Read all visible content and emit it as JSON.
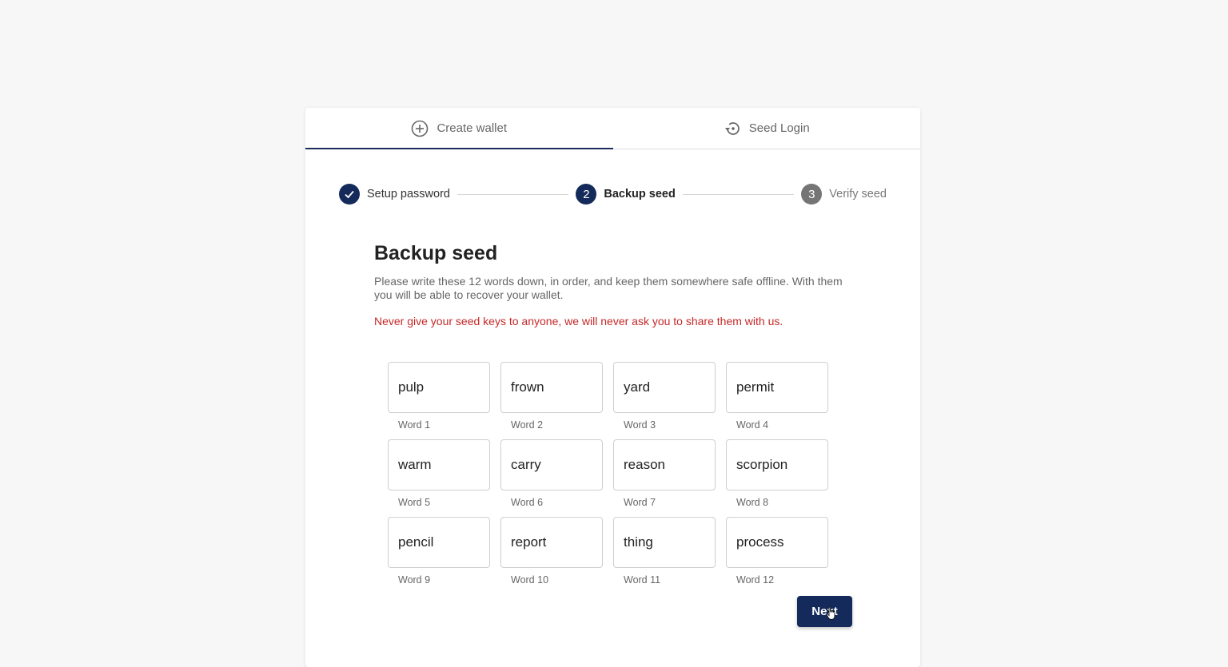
{
  "tabs": [
    {
      "label": "Create wallet",
      "icon": "plus-circle-icon",
      "active": true
    },
    {
      "label": "Seed Login",
      "icon": "restore-icon",
      "active": false
    }
  ],
  "stepper": {
    "steps": [
      {
        "label": "Setup password",
        "number": "",
        "status": "done"
      },
      {
        "label": "Backup seed",
        "number": "2",
        "status": "current"
      },
      {
        "label": "Verify seed",
        "number": "3",
        "status": "pending"
      }
    ]
  },
  "content": {
    "title": "Backup seed",
    "description": "Please write these 12 words down, in order, and keep them somewhere safe offline. With them you will be able to recover your wallet.",
    "warning": "Never give your seed keys to anyone, we will never ask you to share them with us."
  },
  "words": [
    {
      "word": "pulp",
      "label": "Word 1"
    },
    {
      "word": "frown",
      "label": "Word 2"
    },
    {
      "word": "yard",
      "label": "Word 3"
    },
    {
      "word": "permit",
      "label": "Word 4"
    },
    {
      "word": "warm",
      "label": "Word 5"
    },
    {
      "word": "carry",
      "label": "Word 6"
    },
    {
      "word": "reason",
      "label": "Word 7"
    },
    {
      "word": "scorpion",
      "label": "Word 8"
    },
    {
      "word": "pencil",
      "label": "Word 9"
    },
    {
      "word": "report",
      "label": "Word 10"
    },
    {
      "word": "thing",
      "label": "Word 11"
    },
    {
      "word": "process",
      "label": "Word 12"
    }
  ],
  "actions": {
    "next_label": "Next"
  },
  "colors": {
    "primary": "#142a5a",
    "pending": "#757575",
    "warning": "#c62828",
    "muted_text": "#666666"
  }
}
